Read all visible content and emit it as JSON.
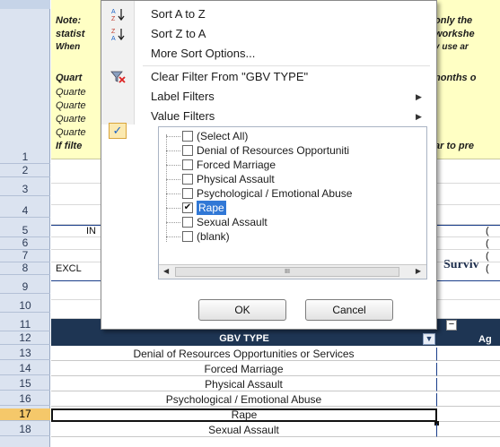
{
  "sheet": {
    "row_numbers": [
      "1",
      "2",
      "3",
      "4",
      "5",
      "6",
      "7",
      "8",
      "9",
      "10",
      "11",
      "12",
      "13",
      "14",
      "15",
      "16",
      "17",
      "18"
    ],
    "notes": {
      "note_prefix": "Note:",
      "statist_prefix": "statist",
      "when_prefix": "When",
      "quart_rows": [
        "Quart",
        "Quarte",
        "Quarte",
        "Quarte",
        "Quarte"
      ],
      "if_filter": "If filte",
      "right_fragments": [
        "only the",
        "workshe",
        "y use ar",
        "nonths o",
        "ar to pre"
      ]
    },
    "row3_heading": "Surviv",
    "row5_left": "IN",
    "row8_left": "EXCL",
    "right_values": [
      "(",
      "(",
      "(",
      "("
    ],
    "gbv_header": "GBV TYPE",
    "ag_header": "Ag",
    "data_rows": [
      "Denial of Resources Opportunities or Services",
      "Forced Marriage",
      "Physical Assault",
      "Psychological / Emotional Abuse",
      "Rape",
      "Sexual Assault"
    ]
  },
  "dropdown": {
    "menu": [
      {
        "label": "Sort A to Z",
        "icon": "sort-az-icon"
      },
      {
        "label": "Sort Z to A",
        "icon": "sort-za-icon"
      },
      {
        "label": "More Sort Options...",
        "icon": ""
      },
      {
        "label": "Clear Filter From \"GBV TYPE\"",
        "icon": "clear-filter-icon"
      },
      {
        "label": "Label Filters",
        "icon": ""
      },
      {
        "label": "Value Filters",
        "icon": ""
      }
    ],
    "checklist": [
      {
        "label": "(Select All)",
        "checked": false
      },
      {
        "label": "Denial of Resources Opportuniti",
        "checked": false
      },
      {
        "label": "Forced Marriage",
        "checked": false
      },
      {
        "label": "Physical Assault",
        "checked": false
      },
      {
        "label": "Psychological / Emotional Abuse",
        "checked": false
      },
      {
        "label": "Rape",
        "checked": true
      },
      {
        "label": "Sexual Assault",
        "checked": false
      },
      {
        "label": "(blank)",
        "checked": false
      }
    ],
    "ok_label": "OK",
    "cancel_label": "Cancel",
    "scroll_thumb_label": "III"
  }
}
